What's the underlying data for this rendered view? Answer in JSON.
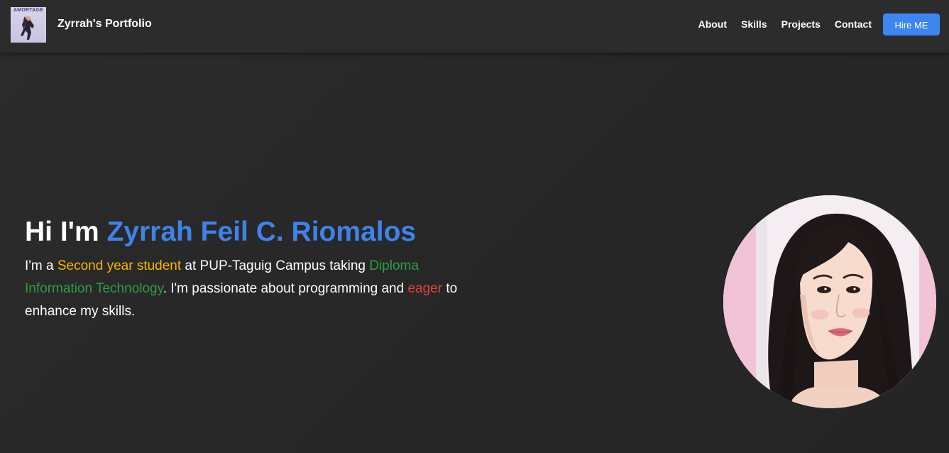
{
  "navbar": {
    "logo_text": "AMORTAGE",
    "brand": "Zyrrah's Portfolio",
    "links": [
      {
        "label": "About"
      },
      {
        "label": "Skills"
      },
      {
        "label": "Projects"
      },
      {
        "label": "Contact"
      }
    ],
    "hire_button": "Hire ME"
  },
  "hero": {
    "greeting": "Hi I'm ",
    "name": "Zyrrah Feil C. Riomalos",
    "intro_1": "I'm a ",
    "highlight_year": "Second year student",
    "intro_2": " at PUP-Taguig Campus taking ",
    "highlight_course": "Diploma Information Technology",
    "intro_3": ". I'm passionate about programming and ",
    "highlight_eager": "eager",
    "intro_4": " to enhance my skills."
  },
  "colors": {
    "accent_blue": "#3f82ea",
    "button_blue": "#3d85f0",
    "highlight_yellow": "#f5b800",
    "highlight_green": "#2f9e44",
    "highlight_red": "#e0443a",
    "background": "#272727",
    "navbar_bg": "#2c2c2c"
  },
  "icons": {
    "logo": "album-cover-logo",
    "portrait": "profile-photo"
  }
}
